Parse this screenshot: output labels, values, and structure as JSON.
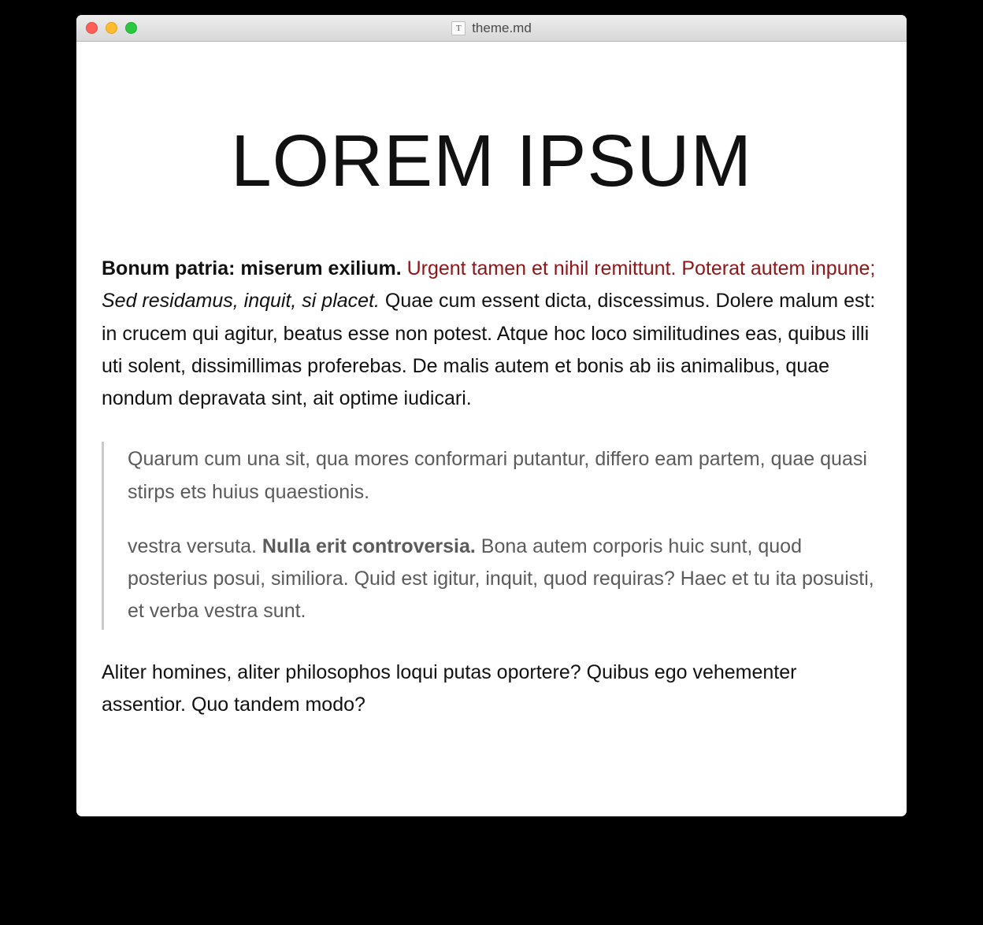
{
  "window": {
    "title": "theme.md",
    "doc_icon_glyph": "T"
  },
  "document": {
    "heading": "LOREM IPSUM",
    "p1": {
      "bold": "Bonum patria: miserum exilium.",
      "link": " Urgent tamen et nihil remittunt. Poterat autem inpune; ",
      "italic": "Sed residamus, inquit, si placet.",
      "rest": " Quae cum essent dicta, discessimus. Dolere malum est: in crucem qui agitur, beatus esse non potest. Atque hoc loco similitudines eas, quibus illi uti solent, dissimillimas proferebas. De malis autem et bonis ab iis animalibus, quae nondum depravata sint, ait optime iudicari."
    },
    "blockquote": {
      "p1": "Quarum cum una sit, qua mores conformari putantur, differo eam partem, quae quasi stirps ets huius quaestionis.",
      "p2": {
        "lead": "vestra versuta. ",
        "bold": "Nulla erit controversia.",
        "rest": " Bona autem corporis huic sunt, quod posterius posui, similiora. Quid est igitur, inquit, quod requiras? Haec et tu ita posuisti, et verba vestra sunt."
      }
    },
    "p2": "Aliter homines, aliter philosophos loqui putas oportere? Quibus ego vehementer assentior. Quo tandem modo?"
  },
  "colors": {
    "link": "#8e1518",
    "blockquote_text": "#5b5b5b",
    "blockquote_border": "#c9c9c9"
  }
}
